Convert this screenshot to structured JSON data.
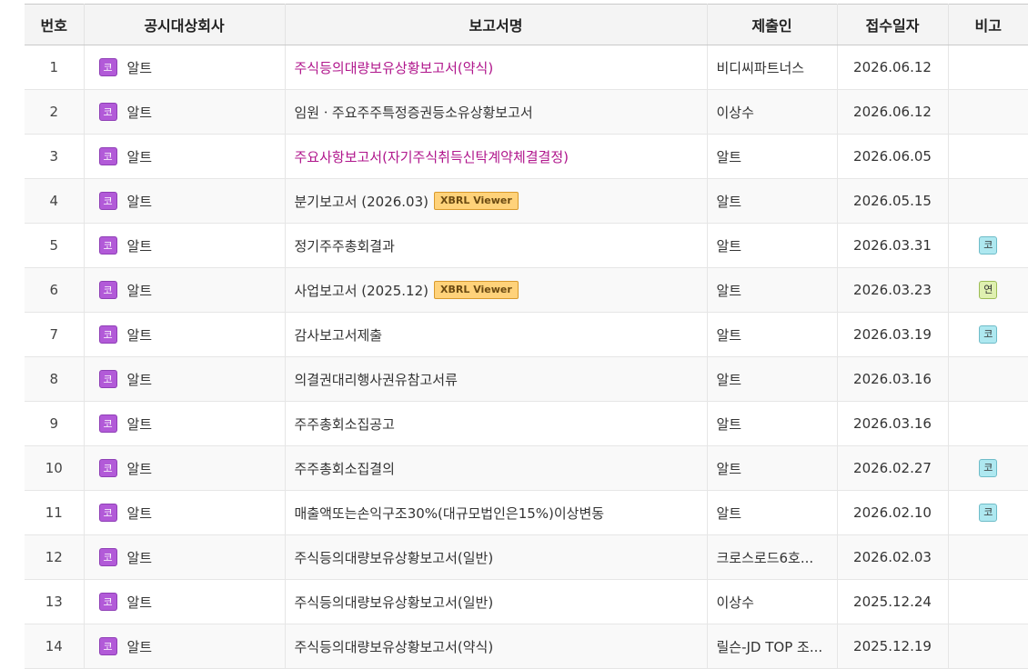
{
  "headers": {
    "num": "번호",
    "company": "공시대상회사",
    "report": "보고서명",
    "filer": "제출인",
    "date": "접수일자",
    "note": "비고"
  },
  "colors": {
    "market_badge": "#b25ad8",
    "highlight_text": "#b0168c",
    "xbrl_badge": "#ffd27a",
    "note_kosdaq": "#aee8f0",
    "note_yeon": "#dff0b0"
  },
  "xbrl_label": "XBRL Viewer",
  "rows": [
    {
      "num": "1",
      "market": "코",
      "company": "알트",
      "report": "주식등의대량보유상황보고서(약식)",
      "highlight": true,
      "xbrl": false,
      "filer": "비디씨파트너스",
      "date": "2026.06.12",
      "note": ""
    },
    {
      "num": "2",
      "market": "코",
      "company": "알트",
      "report": "임원ㆍ주요주주특정증권등소유상황보고서",
      "highlight": false,
      "xbrl": false,
      "filer": "이상수",
      "date": "2026.06.12",
      "note": ""
    },
    {
      "num": "3",
      "market": "코",
      "company": "알트",
      "report": "주요사항보고서(자기주식취득신탁계약체결결정)",
      "highlight": true,
      "xbrl": false,
      "filer": "알트",
      "date": "2026.06.05",
      "note": ""
    },
    {
      "num": "4",
      "market": "코",
      "company": "알트",
      "report": "분기보고서 (2026.03)",
      "highlight": false,
      "xbrl": true,
      "filer": "알트",
      "date": "2026.05.15",
      "note": ""
    },
    {
      "num": "5",
      "market": "코",
      "company": "알트",
      "report": "정기주주총회결과",
      "highlight": false,
      "xbrl": false,
      "filer": "알트",
      "date": "2026.03.31",
      "note": "코"
    },
    {
      "num": "6",
      "market": "코",
      "company": "알트",
      "report": "사업보고서 (2025.12)",
      "highlight": false,
      "xbrl": true,
      "filer": "알트",
      "date": "2026.03.23",
      "note": "연"
    },
    {
      "num": "7",
      "market": "코",
      "company": "알트",
      "report": "감사보고서제출",
      "highlight": false,
      "xbrl": false,
      "filer": "알트",
      "date": "2026.03.19",
      "note": "코"
    },
    {
      "num": "8",
      "market": "코",
      "company": "알트",
      "report": "의결권대리행사권유참고서류",
      "highlight": false,
      "xbrl": false,
      "filer": "알트",
      "date": "2026.03.16",
      "note": ""
    },
    {
      "num": "9",
      "market": "코",
      "company": "알트",
      "report": "주주총회소집공고",
      "highlight": false,
      "xbrl": false,
      "filer": "알트",
      "date": "2026.03.16",
      "note": ""
    },
    {
      "num": "10",
      "market": "코",
      "company": "알트",
      "report": "주주총회소집결의",
      "highlight": false,
      "xbrl": false,
      "filer": "알트",
      "date": "2026.02.27",
      "note": "코"
    },
    {
      "num": "11",
      "market": "코",
      "company": "알트",
      "report": "매출액또는손익구조30%(대규모법인은15%)이상변동",
      "highlight": false,
      "xbrl": false,
      "filer": "알트",
      "date": "2026.02.10",
      "note": "코"
    },
    {
      "num": "12",
      "market": "코",
      "company": "알트",
      "report": "주식등의대량보유상황보고서(일반)",
      "highlight": false,
      "xbrl": false,
      "filer": "크로스로드6호...",
      "date": "2026.02.03",
      "note": ""
    },
    {
      "num": "13",
      "market": "코",
      "company": "알트",
      "report": "주식등의대량보유상황보고서(일반)",
      "highlight": false,
      "xbrl": false,
      "filer": "이상수",
      "date": "2025.12.24",
      "note": ""
    },
    {
      "num": "14",
      "market": "코",
      "company": "알트",
      "report": "주식등의대량보유상황보고서(약식)",
      "highlight": false,
      "xbrl": false,
      "filer": "릴슨-JD TOP 조...",
      "date": "2025.12.19",
      "note": ""
    }
  ]
}
